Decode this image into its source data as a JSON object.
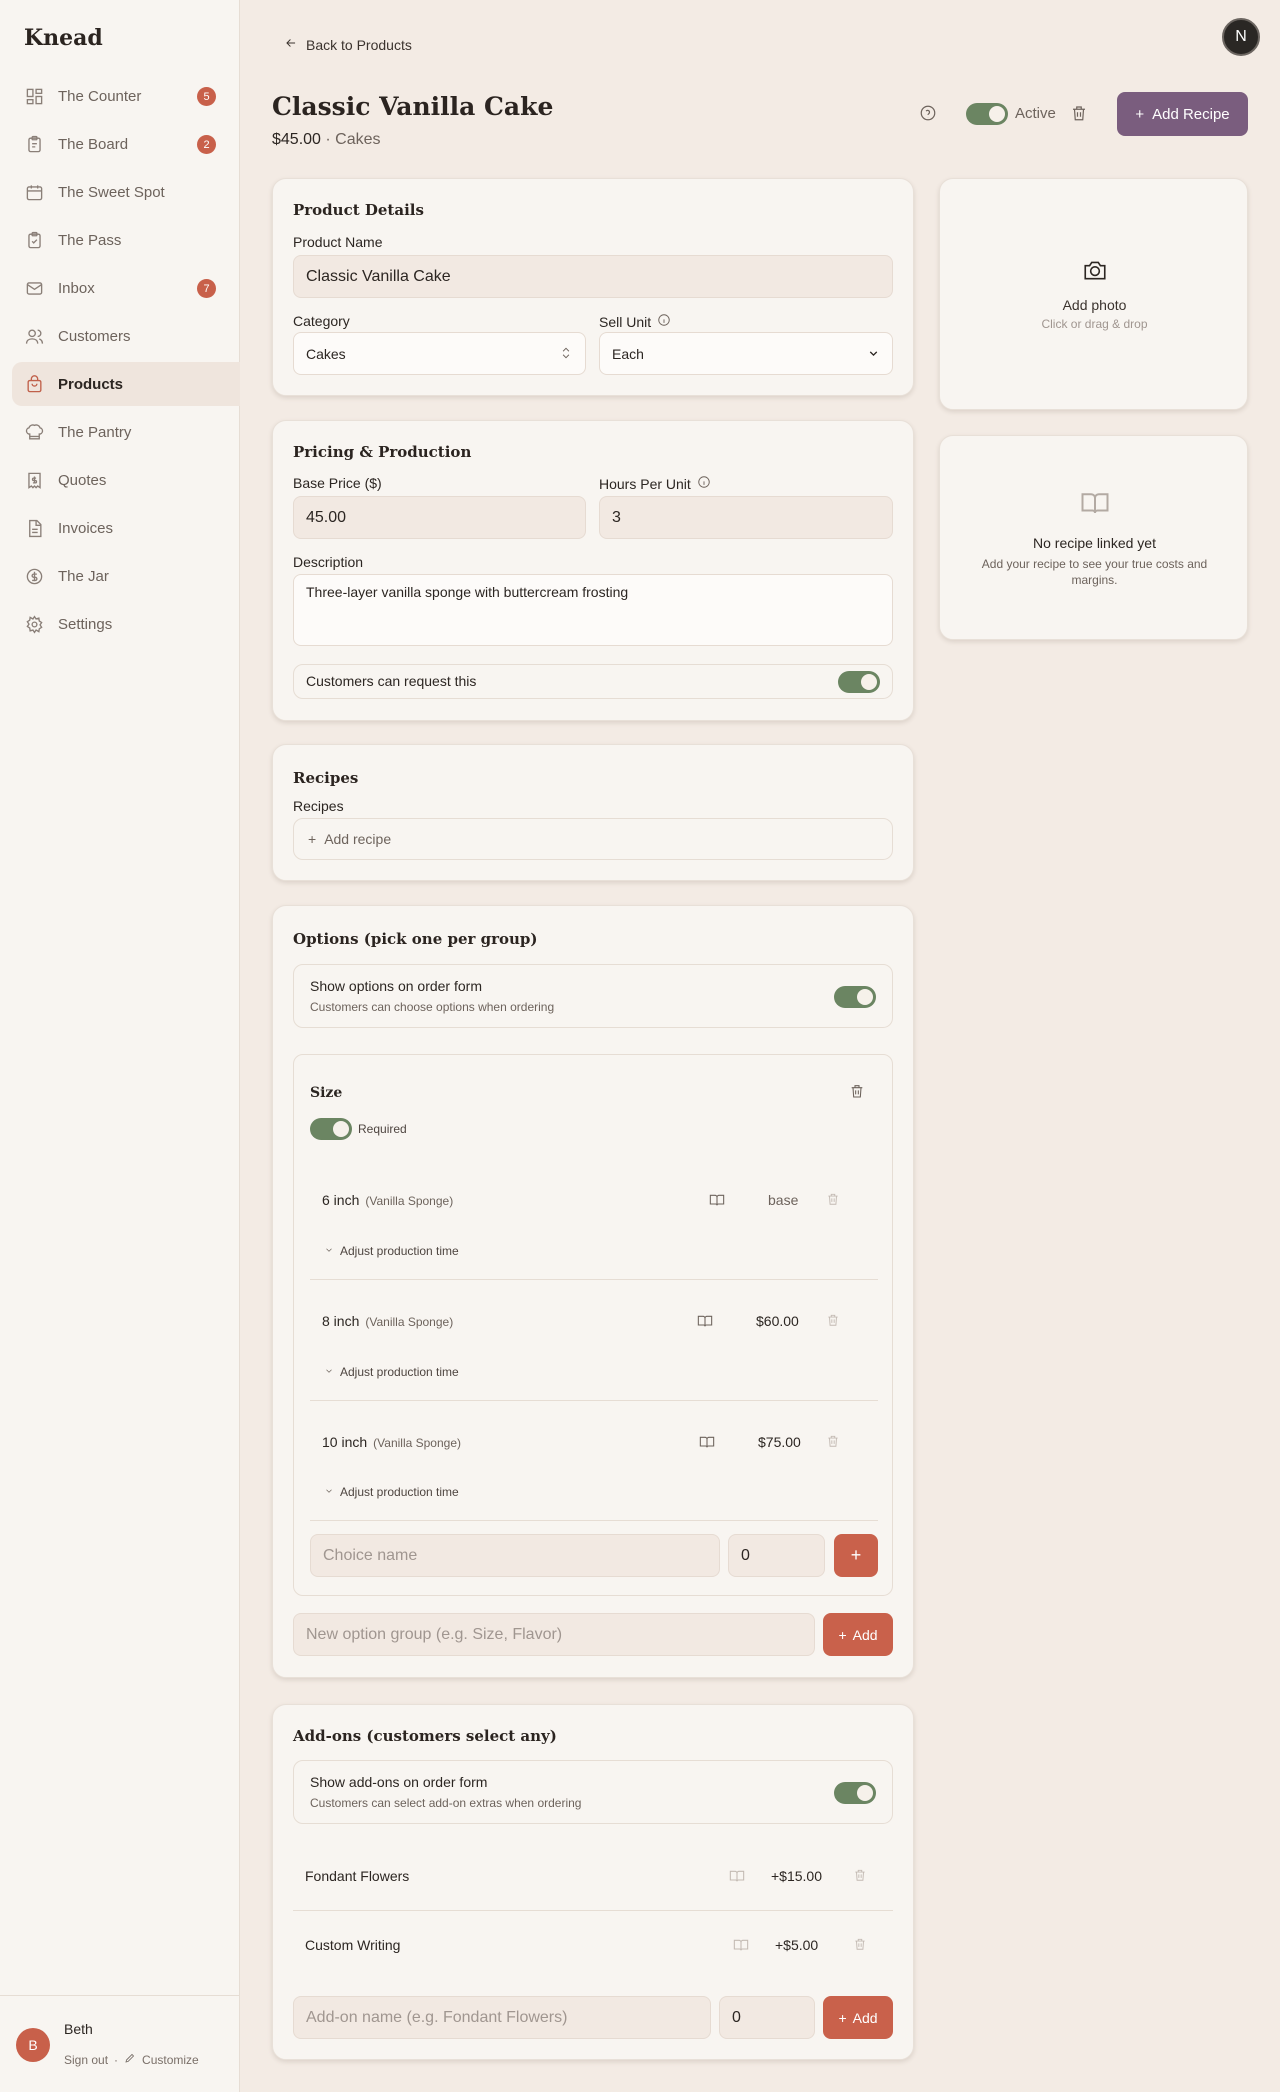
{
  "brand": "Knead",
  "sidebar": {
    "items": [
      {
        "label": "The Counter",
        "icon": "grid-icon",
        "badge": "5"
      },
      {
        "label": "The Board",
        "icon": "clipboard-icon",
        "badge": "2"
      },
      {
        "label": "The Sweet Spot",
        "icon": "calendar-icon",
        "badge": ""
      },
      {
        "label": "The Pass",
        "icon": "clipboard-check-icon",
        "badge": ""
      },
      {
        "label": "Inbox",
        "icon": "mail-icon",
        "badge": "7"
      },
      {
        "label": "Customers",
        "icon": "users-icon",
        "badge": ""
      },
      {
        "label": "Products",
        "icon": "shopping-bag-icon",
        "badge": "",
        "active": true
      },
      {
        "label": "The Pantry",
        "icon": "chef-hat-icon",
        "badge": ""
      },
      {
        "label": "Quotes",
        "icon": "receipt-icon",
        "badge": ""
      },
      {
        "label": "Invoices",
        "icon": "file-text-icon",
        "badge": ""
      },
      {
        "label": "The Jar",
        "icon": "dollar-circle-icon",
        "badge": ""
      },
      {
        "label": "Settings",
        "icon": "gear-icon",
        "badge": ""
      }
    ],
    "user": {
      "initial": "B",
      "name": "Beth",
      "sign_out": "Sign out",
      "separator": "·",
      "customize": "Customize"
    }
  },
  "header": {
    "back": "Back to Products",
    "avatar_initial": "N",
    "title": "Classic Vanilla Cake",
    "price": "$45.00",
    "dot": "·",
    "category": "Cakes",
    "active_label": "Active",
    "add_recipe": "Add Recipe"
  },
  "product_details": {
    "title": "Product Details",
    "name_label": "Product Name",
    "name_value": "Classic Vanilla Cake",
    "category_label": "Category",
    "category_value": "Cakes",
    "sell_unit_label": "Sell Unit",
    "sell_unit_value": "Each"
  },
  "pricing": {
    "title": "Pricing & Production",
    "base_price_label": "Base Price ($)",
    "base_price_value": "45.00",
    "hours_label": "Hours Per Unit",
    "hours_value": "3",
    "description_label": "Description",
    "description_value": "Three-layer vanilla sponge with buttercream frosting",
    "customers_request": "Customers can request this"
  },
  "recipes": {
    "title": "Recipes",
    "label": "Recipes",
    "add": "Add recipe"
  },
  "options": {
    "title": "Options (pick one per group)",
    "show_title": "Show options on order form",
    "show_sub": "Customers can choose options when ordering",
    "group_name": "Size",
    "required": "Required",
    "adjust": "Adjust production time",
    "choices": [
      {
        "name": "6 inch",
        "recipe": "(Vanilla Sponge)",
        "price": "base"
      },
      {
        "name": "8 inch",
        "recipe": "(Vanilla Sponge)",
        "price": "$60.00"
      },
      {
        "name": "10 inch",
        "recipe": "(Vanilla Sponge)",
        "price": "$75.00"
      }
    ],
    "choice_placeholder": "Choice name",
    "choice_price_value": "0",
    "plus": "+",
    "new_group_placeholder": "New option group (e.g. Size, Flavor)",
    "add": "Add"
  },
  "addons": {
    "title": "Add-ons (customers select any)",
    "show_title": "Show add-ons on order form",
    "show_sub": "Customers can select add-on extras when ordering",
    "items": [
      {
        "name": "Fondant Flowers",
        "price": "+$15.00"
      },
      {
        "name": "Custom Writing",
        "price": "+$5.00"
      }
    ],
    "name_placeholder": "Add-on name (e.g. Fondant Flowers)",
    "price_value": "0",
    "add": "Add"
  },
  "photo": {
    "title": "Add photo",
    "sub": "Click or drag & drop"
  },
  "recipe_panel": {
    "title": "No recipe linked yet",
    "sub": "Add your recipe to see your true costs and margins."
  },
  "colors": {
    "accent": "#c9614b",
    "purple": "#7a5d7e",
    "toggle": "#6b8562",
    "bg": "#f3ebe4"
  }
}
